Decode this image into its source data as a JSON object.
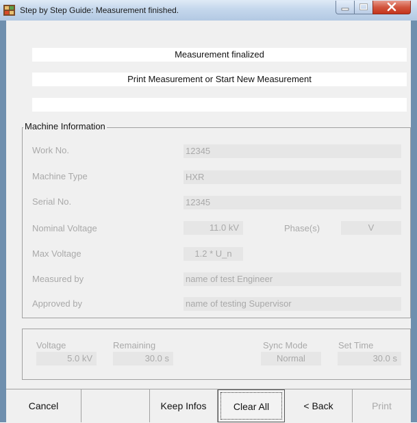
{
  "window": {
    "title": "Step by Step Guide: Measurement finished.",
    "controls": [
      "minimize-icon",
      "maximize-icon",
      "close-icon"
    ]
  },
  "status": {
    "line1": "Measurement finalized",
    "line2": "Print Measurement or Start New Measurement",
    "line3": ""
  },
  "machine_info": {
    "title": "Machine Information",
    "work_no": {
      "label": "Work No.",
      "value": "12345"
    },
    "machine_type": {
      "label": "Machine Type",
      "value": "HXR"
    },
    "serial_no": {
      "label": "Serial No.",
      "value": "12345"
    },
    "nominal_voltage": {
      "label": "Nominal Voltage",
      "value": "11.0 kV"
    },
    "phase": {
      "label": "Phase(s)",
      "value": "V"
    },
    "max_voltage": {
      "label": "Max Voltage",
      "value": "1.2 * U_n"
    },
    "measured_by": {
      "label": "Measured by",
      "value": "name of test Engineer"
    },
    "approved_by": {
      "label": "Approved by",
      "value": "name of testing Supervisor"
    }
  },
  "params": {
    "voltage": {
      "label": "Voltage",
      "value": "5.0 kV"
    },
    "remaining": {
      "label": "Remaining",
      "value": "30.0  s"
    },
    "sync_mode": {
      "label": "Sync Mode",
      "value": "Normal"
    },
    "set_time": {
      "label": "Set Time",
      "value": "30.0  s"
    }
  },
  "buttons": {
    "cancel": "Cancel",
    "blank": "",
    "keep_infos": "Keep Infos",
    "clear_all": "Clear All",
    "back": "< Back",
    "print": "Print"
  },
  "colors": {
    "titlebar": "#c4d7ec",
    "close_button": "#d2563f",
    "disabled_text": "#a9a9a9",
    "field_bg": "#e6e6e6"
  }
}
